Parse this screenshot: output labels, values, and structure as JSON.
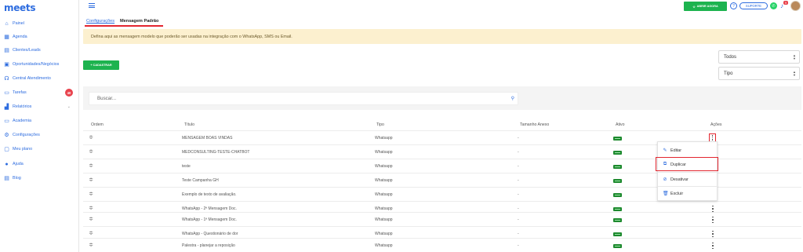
{
  "app": {
    "logo": "meets"
  },
  "sidebar": {
    "items": [
      {
        "label": "Painel",
        "icon": "home-icon"
      },
      {
        "label": "Agenda",
        "icon": "calendar-icon"
      },
      {
        "label": "Clientes/Leads",
        "icon": "contacts-icon"
      },
      {
        "label": "Oportunidades/Negócios",
        "icon": "briefcase-icon"
      },
      {
        "label": "Central Atendimento",
        "icon": "headset-icon"
      },
      {
        "label": "Tarefas",
        "icon": "tasks-icon",
        "badge": "40"
      },
      {
        "label": "Relatórios",
        "icon": "bar-chart-icon"
      },
      {
        "label": "Academia",
        "icon": "monitor-icon"
      },
      {
        "label": "Configurações",
        "icon": "gear-icon"
      },
      {
        "label": "Meu plano",
        "icon": "plan-icon"
      },
      {
        "label": "Ajuda",
        "icon": "help-icon"
      },
      {
        "label": "Blog",
        "icon": "blog-icon"
      }
    ]
  },
  "topbar": {
    "abrir_label": "ABRIR AGORA",
    "help_glyph": "?",
    "suporte_label": "SUPORTE",
    "notification_count": "9"
  },
  "tabs": {
    "configuracoes": "Configurações",
    "mensagem_padrao": "Mensagem Padrão"
  },
  "banner": {
    "text": "Defina aqui as mensagem modelo que poderão ser usadas na integração com o WhatsApp, SMS ou Email."
  },
  "actions": {
    "cadastrar": "+ CADASTRAR"
  },
  "filters": {
    "status": "Todos",
    "type": "Tipo"
  },
  "search": {
    "placeholder": "Buscar..."
  },
  "table": {
    "headers": {
      "ordem": "Ordem",
      "titulo": "Título",
      "tipo": "Tipo",
      "tamanho": "Tamanho Anexo",
      "ativo": "Ativo",
      "acoes": "Ações"
    },
    "rows": [
      {
        "titulo": "MENSAGEM BOAS VINDAS",
        "tipo": "Whatsapp",
        "tamanho": "-"
      },
      {
        "titulo": "MEDCONSULTING-TESTE-CHATBOT",
        "tipo": "Whatsapp",
        "tamanho": "-"
      },
      {
        "titulo": "teste",
        "tipo": "Whatsapp",
        "tamanho": "-"
      },
      {
        "titulo": "Teste Campanha GH",
        "tipo": "Whatsapp",
        "tamanho": "-"
      },
      {
        "titulo": "Exemplo de texto de avaliação.",
        "tipo": "Whatsapp",
        "tamanho": "-"
      },
      {
        "titulo": "WhatsApp - 2ª Mensagem Doc.",
        "tipo": "Whatsapp",
        "tamanho": "-"
      },
      {
        "titulo": "WhatsApp - 1ª Mensagem Doc.",
        "tipo": "Whatsapp",
        "tamanho": "-"
      },
      {
        "titulo": "WhatsApp - Questionário de dor",
        "tipo": "Whatsapp",
        "tamanho": "-"
      },
      {
        "titulo": "Palestra - planejar a reposição",
        "tipo": "Whatsapp",
        "tamanho": "-"
      }
    ]
  },
  "context_menu": {
    "editar": "Editar",
    "duplicar": "Duplicar",
    "desativar": "Desativar",
    "excluir": "Excluir"
  },
  "colors": {
    "brand_blue": "#2d6cdf",
    "green": "#1db34f",
    "highlight_red": "#e3262f",
    "banner_bg": "#fcf0cf"
  }
}
